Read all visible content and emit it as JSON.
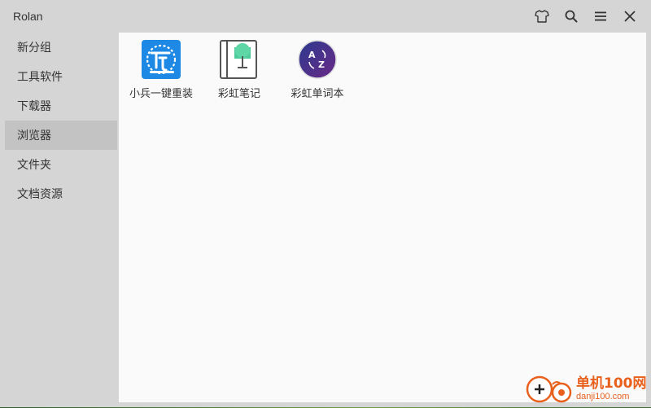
{
  "window": {
    "title": "Rolan"
  },
  "controls": [
    {
      "icon": "shirt-icon",
      "label": ""
    },
    {
      "icon": "search-icon",
      "label": ""
    },
    {
      "icon": "menu-icon",
      "label": ""
    },
    {
      "icon": "close-icon",
      "label": ""
    }
  ],
  "sidebar": {
    "items": [
      {
        "label": "新分组"
      },
      {
        "label": "工具软件"
      },
      {
        "label": "下载器"
      },
      {
        "label": "浏览器",
        "selected": true
      },
      {
        "label": "文件夹"
      },
      {
        "label": "文档资源"
      }
    ]
  },
  "apps": [
    {
      "label": "小兵一键重装",
      "icon": "xiaobing-reinstall-icon",
      "color": "#1e88e5"
    },
    {
      "label": "彩虹笔记",
      "icon": "rainbow-notes-icon",
      "color": "#4ecb9a"
    },
    {
      "label": "彩虹单词本",
      "icon": "rainbow-vocabulary-icon",
      "color": "#4a2a8a"
    }
  ],
  "watermark": {
    "main": "单机100网",
    "sub": "danji100.com",
    "color": "#e8601c"
  }
}
